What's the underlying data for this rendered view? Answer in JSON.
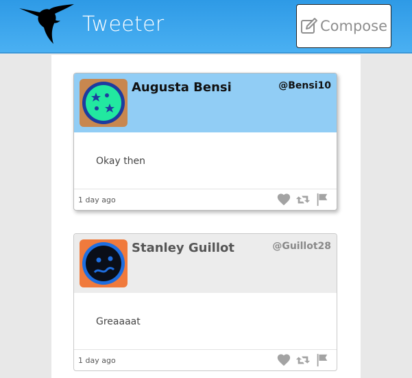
{
  "brand": {
    "name": "Tweeter",
    "logo_icon": "hummingbird-icon"
  },
  "compose": {
    "label": "Compose",
    "icon": "edit-icon"
  },
  "tweets": [
    {
      "name": "Augusta Bensi",
      "handle": "@Bensi10",
      "text": "Okay then",
      "time": "1 day ago",
      "avatar": {
        "bg": "#c8874f",
        "face": "#22e8a0",
        "ring": "#1d3ba0"
      }
    },
    {
      "name": "Stanley Guillot",
      "handle": "@Guillot28",
      "text": "Greaaaat",
      "time": "1 day ago",
      "avatar": {
        "bg": "#f07a3c",
        "face": "#0a0e18",
        "ring": "#1e6ee0"
      }
    }
  ],
  "colors": {
    "navbar": "#3aa6ec",
    "tweet_header_active": "#91cdf5",
    "tweet_header": "#ececec",
    "action_icon": "#a3a3a3"
  }
}
